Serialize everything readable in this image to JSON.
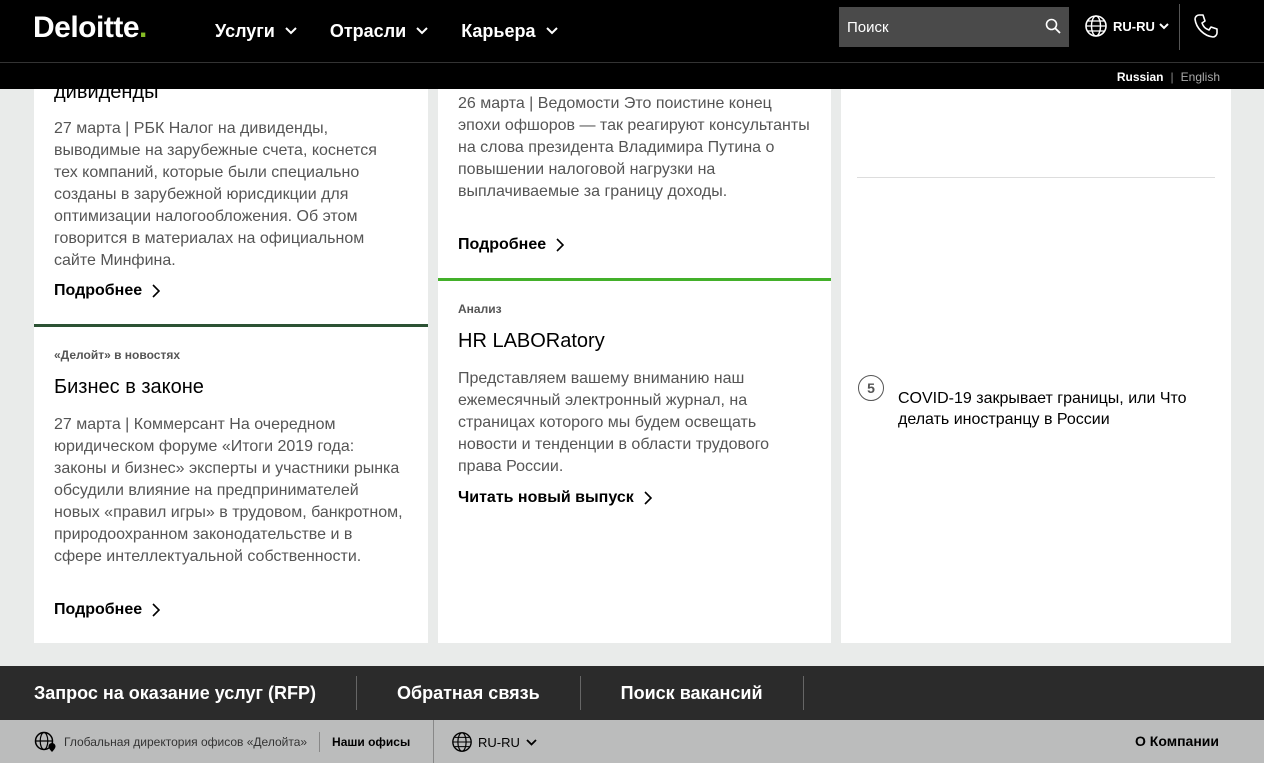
{
  "header": {
    "logo_text": "Deloitte",
    "logo_dot": ".",
    "nav": [
      "Услуги",
      "Отрасли",
      "Карьера"
    ],
    "search_placeholder": "Поиск",
    "locale": "RU-RU",
    "languages": {
      "current": "Russian",
      "separator": "|",
      "other": "English"
    }
  },
  "col1": {
    "title_fragment": "дивиденды",
    "desc1": "27 марта | РБК Налог на дивиденды, выводимые на зарубежные счета, коснется тех компаний, которые были специально созданы в зарубежной юрисдикции для оптимизации налогообложения. Об этом говорится в материалах на официальном сайте Минфина.",
    "more1": "Подробнее",
    "category2": "«Делойт» в новостях",
    "title2": "Бизнес в законе",
    "desc2": "27 марта | Коммерсант На очередном юридическом форуме «Итоги 2019 года: законы и бизнес» эксперты и участники рынка обсудили влияние на предпринимателей новых «правил игры» в трудовом, банкротном, природоохранном законодательстве и в сфере интеллектуальной собственности.",
    "more2": "Подробнее"
  },
  "col2": {
    "desc1": "26 марта | Ведомости Это поистине конец эпохи офшоров — так реагируют консультанты на слова президента Владимира Путина о повышении налоговой нагрузки на выплачиваемые за границу доходы.",
    "more1": "Подробнее",
    "category2": "Анализ",
    "title2": "HR LABORatory",
    "desc2": "Представляем вашему вниманию наш ежемесячный электронный журнал, на страницах которого мы будем освещать новости и тенденции в области трудового права России.",
    "more2": "Читать новый выпуск"
  },
  "col3": {
    "rank_number": "5",
    "rank_text": "COVID-19 закрывает границы, или Что делать иностранцу в России"
  },
  "footer": {
    "links": [
      "Запрос на оказание услуг (RFP)",
      "Обратная связь",
      "Поиск вакансий"
    ],
    "directory": "Глобальная директория офисов «Делойта»",
    "offices": "Наши офисы",
    "locale": "RU-RU",
    "about": "О Компании"
  },
  "colors": {
    "brand_green": "#86bc25",
    "accent_green": "#43b02a",
    "dark_green": "#2c5234"
  }
}
